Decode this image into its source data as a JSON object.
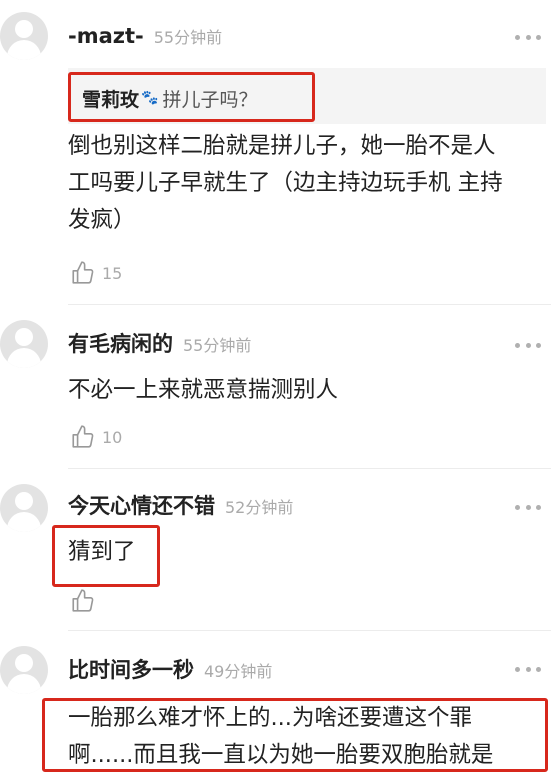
{
  "comments": [
    {
      "username": "-mazt-",
      "time": "55分钟前",
      "quote": {
        "name": "雪莉玫",
        "emoji": "🐾",
        "text": "拼儿子吗？"
      },
      "text_lines": [
        "倒也别这样二胎就是拼儿子，她一胎不是人",
        "工吗要儿子早就生了（边主持边玩手机 主持",
        "发疯）"
      ],
      "likes": "15"
    },
    {
      "username": "有毛病闲的",
      "time": "55分钟前",
      "text_lines": [
        "不必一上来就恶意揣测别人"
      ],
      "likes": "10"
    },
    {
      "username": "今天心情还不错",
      "time": "52分钟前",
      "text_lines": [
        "猜到了"
      ],
      "likes": ""
    },
    {
      "username": "比时间多一秒",
      "time": "49分钟前",
      "text_lines": [
        "一胎那么难才怀上的...为啥还要遭这个罪",
        "啊......而且我一直以为她一胎要双胞胎就是"
      ]
    }
  ],
  "colors": {
    "highlight": "#d7281c",
    "muted": "#aaaaaa"
  },
  "icons": {
    "like": "thumbs-up-icon",
    "more": "more-dots-icon",
    "avatar": "default-avatar-icon"
  }
}
